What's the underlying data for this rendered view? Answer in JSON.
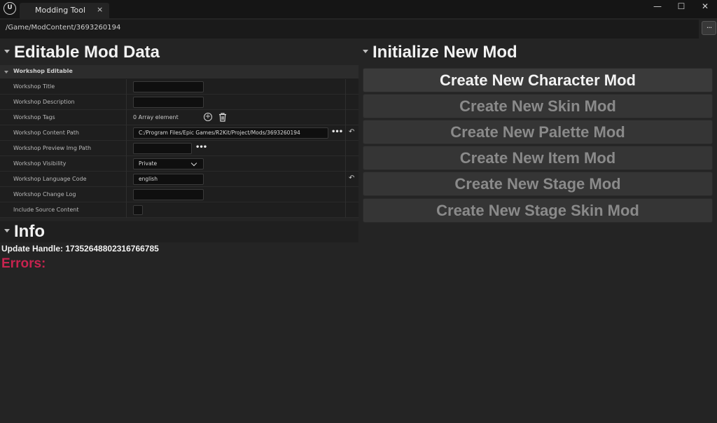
{
  "window": {
    "tab_label": "Modding Tool",
    "tab_close": "×",
    "logo_text": "U",
    "minimize": "—",
    "maximize": "☐",
    "close": "✕"
  },
  "pathbar": {
    "path": "/Game/ModContent/3693260194",
    "browse_label": "..."
  },
  "editable": {
    "title": "Editable Mod Data",
    "category": "Workshop Editable",
    "props": {
      "title_label": "Workshop Title",
      "title_value": "",
      "description_label": "Workshop Description",
      "description_value": "",
      "tags_label": "Workshop Tags",
      "tags_value": "0 Array element",
      "content_path_label": "Workshop Content Path",
      "content_path_value": "C:/Program Files/Epic Games/R2Kit/Project/Mods/3693260194",
      "preview_label": "Workshop Preview Img Path",
      "preview_value": "",
      "visibility_label": "Workshop Visibility",
      "visibility_value": "Private",
      "language_label": "Workshop Language Code",
      "language_value": "english",
      "changelog_label": "Workshop Change Log",
      "changelog_value": "",
      "source_label": "Include Source Content",
      "source_checked": false
    },
    "browse_dots": "•••",
    "reset_glyph": "↶",
    "add_glyph": "+"
  },
  "info": {
    "title": "Info",
    "update_handle": "Update Handle: 17352648802316766785",
    "errors_label": "Errors:"
  },
  "init": {
    "title": "Initialize New Mod",
    "buttons": [
      {
        "label": "Create New Character Mod",
        "enabled": true
      },
      {
        "label": "Create New Skin Mod",
        "enabled": false
      },
      {
        "label": "Create New Palette Mod",
        "enabled": false
      },
      {
        "label": "Create New Item Mod",
        "enabled": false
      },
      {
        "label": "Create New Stage Mod",
        "enabled": false
      },
      {
        "label": "Create New Stage Skin Mod",
        "enabled": false
      }
    ]
  },
  "colors": {
    "background": "#242424",
    "titlebar": "#151515",
    "error": "#c8234f",
    "button": "#353535"
  },
  "icons": [
    "unreal-logo-icon",
    "close-icon",
    "minimize-icon",
    "maximize-icon",
    "collapse-arrow-icon",
    "add-element-icon",
    "trash-icon",
    "browse-dots-icon",
    "reset-arrow-icon",
    "chevron-down-icon"
  ]
}
